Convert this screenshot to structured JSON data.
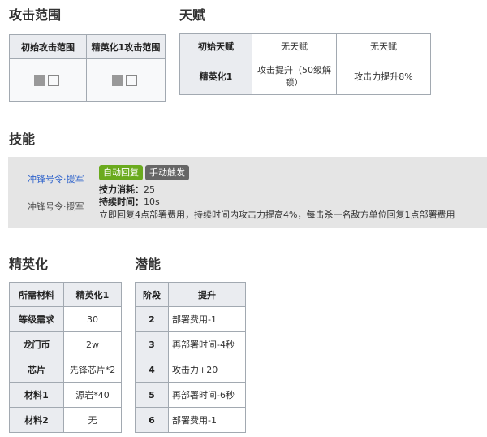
{
  "attack_range": {
    "heading": "攻击范围",
    "col1": "初始攻击范围",
    "col2": "精英化1攻击范围"
  },
  "talent": {
    "heading": "天赋",
    "rows": [
      {
        "label": "初始天赋",
        "c1": "无天赋",
        "c2": "无天赋"
      },
      {
        "label": "精英化1",
        "c1": "攻击提升（50级解锁）",
        "c2": "攻击力提升8%"
      }
    ]
  },
  "skill": {
    "heading": "技能",
    "name_link": "冲锋号令·援军",
    "name": "冲锋号令·援军",
    "tag_recovery": "自动回复",
    "tag_trigger": "手动触发",
    "cost_label": "技力消耗：",
    "cost_value": "25",
    "duration_label": "持续时间：",
    "duration_value": "10s",
    "description": "立即回复4点部署费用，持续时间内攻击力提高4%，每击杀一名敌方单位回复1点部署费用"
  },
  "elite": {
    "heading": "精英化",
    "header": [
      "所需材料",
      "精英化1"
    ],
    "rows": [
      {
        "label": "等级需求",
        "value": "30"
      },
      {
        "label": "龙门币",
        "value": "2w"
      },
      {
        "label": "芯片",
        "value": "先锋芯片*2"
      },
      {
        "label": "材料1",
        "value": "源岩*40"
      },
      {
        "label": "材料2",
        "value": "无"
      }
    ]
  },
  "potential": {
    "heading": "潜能",
    "header": [
      "阶段",
      "提升"
    ],
    "rows": [
      {
        "stage": "2",
        "effect": "部署费用-1"
      },
      {
        "stage": "3",
        "effect": "再部署时间-4秒"
      },
      {
        "stage": "4",
        "effect": "攻击力+20"
      },
      {
        "stage": "5",
        "effect": "再部署时间-6秒"
      },
      {
        "stage": "6",
        "effect": "部署费用-1"
      }
    ]
  }
}
